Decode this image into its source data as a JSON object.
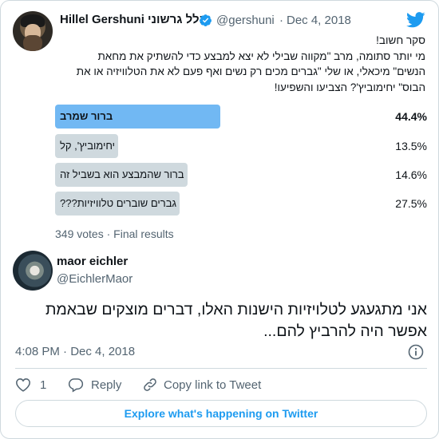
{
  "tweet": {
    "author_name": "Hillel Gershuni הלל גרשוני",
    "author_handle": "@gershuni",
    "separator": "·",
    "date": "Dec 4, 2018",
    "text_lines": [
      "סקר חשוב!",
      "מי יותר סתומה, מרב \"מקווה שבילי לא יצא למבצע כדי להשתיק את מחאת",
      "הנשים\" מיכאלי, או שלי \"גברים מכים רק נשים ואף פעם לא את הטלוויזיה או את",
      "הבוס\" יחימוביץ'? הצביעו והשפיעו!"
    ],
    "poll": {
      "options": [
        {
          "label": "ברור שמרב",
          "percent": 44.4,
          "percent_text": "44.4%",
          "winner": true
        },
        {
          "label": "יחימוביץ', קל",
          "percent": 13.5,
          "percent_text": "13.5%",
          "winner": false
        },
        {
          "label": "ברור שהמבצע הוא בשביל זה",
          "percent": 14.6,
          "percent_text": "14.6%",
          "winner": false
        },
        {
          "label": "גברים שוברים טלוויזיות???",
          "percent": 27.5,
          "percent_text": "27.5%",
          "winner": false
        }
      ],
      "meta": "349 votes · Final results"
    }
  },
  "reply": {
    "author_name": "maor eichler",
    "author_handle": "@EichlerMaor",
    "text": "אני מתגעגע לטלויזיות הישנות האלו, דברים מוצקים שבאמת אפשר היה להרביץ להם...",
    "timestamp": "4:08 PM · Dec 4, 2018",
    "likes": "1",
    "reply_label": "Reply",
    "copy_label": "Copy link to Tweet",
    "explore_label": "Explore what's happening on Twitter"
  },
  "colors": {
    "accent": "#1d9bf0",
    "poll_winner": "#71b8f3",
    "poll_other": "#cfd9de",
    "secondary_text": "#536471"
  },
  "icons": [
    "verified-badge-icon",
    "twitter-bird-icon",
    "info-icon",
    "heart-icon",
    "reply-icon",
    "link-icon"
  ]
}
